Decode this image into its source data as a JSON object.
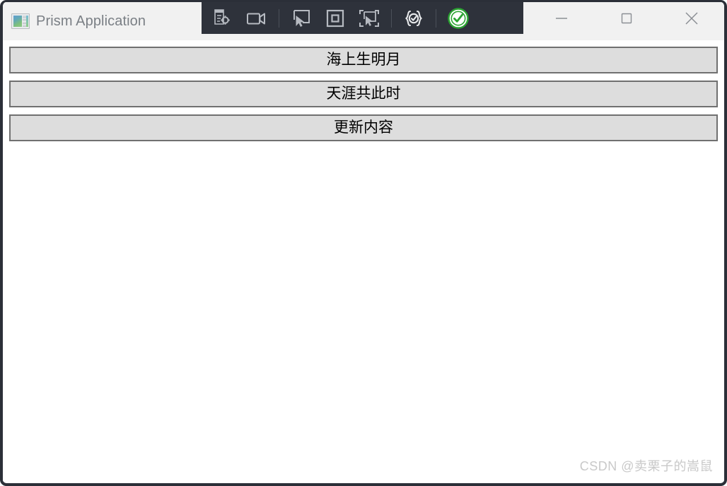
{
  "window": {
    "title": "Prism Application",
    "app_icon": "prism-app-icon",
    "frame_color": "#2b2f38",
    "titlebar_bg": "#f1f1f1",
    "client_bg": "#ffffff"
  },
  "inspector_toolbar": {
    "background": "#2e323b",
    "icon_color": "#b6bac1",
    "accent_color": "#2ba432",
    "items": [
      {
        "name": "inspect-element-properties-icon",
        "label": "Inspect Element Properties"
      },
      {
        "name": "record-video-icon",
        "label": "Record"
      },
      {
        "name": "select-element-icon",
        "label": "Select Element"
      },
      {
        "name": "highlight-element-icon",
        "label": "Highlight Element"
      },
      {
        "name": "pick-element-icon",
        "label": "Pick Element"
      },
      {
        "name": "code-validate-icon",
        "label": "Validate Code"
      },
      {
        "name": "confirm-check-icon",
        "label": "Confirm"
      }
    ]
  },
  "window_controls": {
    "minimize": {
      "name": "minimize-icon",
      "label": "Minimize"
    },
    "maximize": {
      "name": "maximize-icon",
      "label": "Maximize"
    },
    "close": {
      "name": "close-icon",
      "label": "Close"
    }
  },
  "content": {
    "buttons": [
      {
        "label": "海上生明月"
      },
      {
        "label": "天涯共此时"
      },
      {
        "label": "更新内容"
      }
    ]
  },
  "watermark": {
    "text": "CSDN @卖栗子的嵩鼠"
  }
}
